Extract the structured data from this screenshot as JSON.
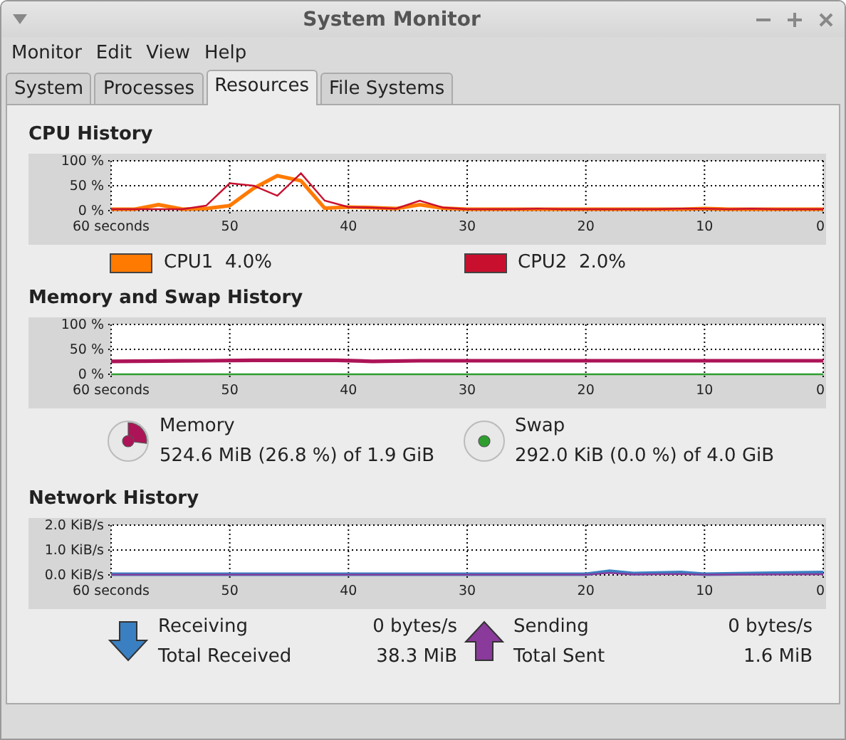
{
  "window": {
    "title": "System Monitor"
  },
  "menu": [
    "Monitor",
    "Edit",
    "View",
    "Help"
  ],
  "tabs": [
    {
      "label": "System",
      "selected": false
    },
    {
      "label": "Processes",
      "selected": false
    },
    {
      "label": "Resources",
      "selected": true
    },
    {
      "label": "File Systems",
      "selected": false
    }
  ],
  "cpu": {
    "title": "CPU History",
    "chart_data": {
      "type": "line",
      "grid": true,
      "x": [
        60,
        58,
        56,
        54,
        52,
        50,
        48,
        46,
        44,
        42,
        40,
        38,
        36,
        34,
        32,
        30,
        28,
        26,
        24,
        22,
        20,
        18,
        16,
        14,
        12,
        10,
        8,
        6,
        4,
        2,
        0
      ],
      "ylim": [
        0,
        100
      ],
      "xlim": [
        60,
        0
      ],
      "xticks": [
        {
          "value": 60,
          "label": "60 seconds"
        },
        50,
        40,
        30,
        20,
        10,
        0
      ],
      "yticks": [
        {
          "value": 0,
          "label": "0 %"
        },
        {
          "value": 50,
          "label": "50 %"
        },
        {
          "value": 100,
          "label": "100 %"
        }
      ],
      "series": [
        {
          "name": "CPU1",
          "color": "#ff7a00",
          "values": [
            3,
            3,
            12,
            3,
            4,
            10,
            45,
            70,
            60,
            5,
            7,
            6,
            4,
            12,
            5,
            3,
            3,
            3,
            3,
            3,
            3,
            3,
            3,
            3,
            3,
            4,
            3,
            3,
            3,
            3,
            3
          ]
        },
        {
          "name": "CPU2",
          "color": "#c8102e",
          "values": [
            3,
            3,
            3,
            3,
            10,
            55,
            50,
            30,
            75,
            20,
            7,
            6,
            4,
            20,
            6,
            3,
            3,
            3,
            4,
            3,
            3,
            3,
            3,
            3,
            4,
            4,
            3,
            4,
            3,
            3,
            3
          ]
        }
      ]
    },
    "legend": [
      {
        "value": "4.0%",
        "color": "#ff7a00"
      },
      {
        "value": "2.0%",
        "color": "#c8102e"
      }
    ]
  },
  "memory": {
    "title": "Memory and Swap History",
    "chart_data": {
      "type": "line",
      "grid": true,
      "x": [
        60,
        52,
        48,
        41,
        38,
        34,
        30,
        20,
        10,
        0
      ],
      "ylim": [
        0,
        100
      ],
      "xlim": [
        60,
        0
      ],
      "xticks": [
        {
          "value": 60,
          "label": "60 seconds"
        },
        50,
        40,
        30,
        20,
        10,
        0
      ],
      "yticks": [
        {
          "value": 0,
          "label": "0 %"
        },
        {
          "value": 50,
          "label": "50 %"
        },
        {
          "value": 100,
          "label": "100 %"
        }
      ],
      "series": [
        {
          "name": "Memory",
          "color": "#ad1457",
          "values": [
            26,
            27,
            28,
            28,
            26,
            27,
            27,
            27,
            27,
            27
          ]
        },
        {
          "name": "Swap",
          "color": "#2e9e2e",
          "values": [
            0,
            0,
            0,
            0,
            0,
            0,
            0,
            0,
            0,
            0
          ]
        }
      ]
    },
    "legend": [
      {
        "detail": "524.6 MiB (26.8 %) of 1.9 GiB",
        "color": "#ad1457"
      },
      {
        "detail": "292.0 KiB (0.0 %) of 4.0 GiB",
        "color": "#2e9e2e"
      }
    ]
  },
  "network": {
    "title": "Network History",
    "chart_data": {
      "type": "line",
      "grid": true,
      "x": [
        60,
        50,
        40,
        30,
        20,
        18,
        16,
        12,
        10,
        0
      ],
      "ylim": [
        0,
        2
      ],
      "xlim": [
        60,
        0
      ],
      "xticks": [
        {
          "value": 60,
          "label": "60 seconds"
        },
        50,
        40,
        30,
        20,
        10,
        0
      ],
      "yticks": [
        {
          "value": 0,
          "label": "0.0 KiB/s"
        },
        {
          "value": 1,
          "label": "1.0 KiB/s"
        },
        {
          "value": 2,
          "label": "2.0 KiB/s"
        }
      ],
      "series": [
        {
          "name": "Receiving",
          "color": "#3a7fc1",
          "values": [
            0.03,
            0.03,
            0.03,
            0.03,
            0.03,
            0.15,
            0.05,
            0.1,
            0.03,
            0.1
          ]
        },
        {
          "name": "Sending",
          "color": "#8a3a9a",
          "values": [
            0.01,
            0.01,
            0.01,
            0.01,
            0.01,
            0.08,
            0.02,
            0.04,
            0.01,
            0.03
          ]
        }
      ]
    },
    "legend": [
      {
        "kind": "receive",
        "value": "0 bytes/s",
        "total_label": "Total Received",
        "total": "38.3 MiB",
        "color": "#3a7fc1"
      },
      {
        "kind": "send",
        "value": "0 bytes/s",
        "total_label": "Total Sent",
        "total": "1.6 MiB",
        "color": "#8a3a9a"
      }
    ]
  }
}
